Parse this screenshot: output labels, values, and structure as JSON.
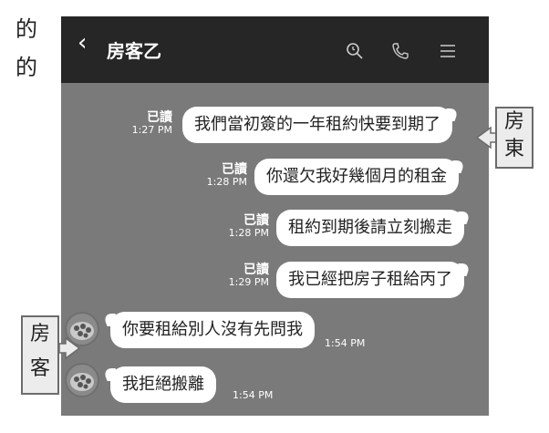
{
  "page_side_text": [
    "的",
    "的"
  ],
  "header": {
    "back_icon": "‹",
    "title": "房客乙"
  },
  "messages_right": [
    {
      "text": "我們當初簽的一年租約快要到期了",
      "status": "已讀",
      "time": "1:27 PM"
    },
    {
      "text": "你還欠我好幾個月的租金",
      "status": "已讀",
      "time": "1:28 PM"
    },
    {
      "text": "租約到期後請立刻搬走",
      "status": "已讀",
      "time": "1:28 PM"
    },
    {
      "text": "我已經把房子租給丙了",
      "status": "已讀",
      "time": "1:29 PM"
    }
  ],
  "messages_left": [
    {
      "text": "你要租給別人沒有先問我",
      "time": "1:54 PM"
    },
    {
      "text": "我拒絕搬離",
      "time": "1:54 PM"
    }
  ],
  "callouts": {
    "landlord": "房東",
    "tenant": "房客"
  },
  "colors": {
    "header": "#262626",
    "chat_bg": "#7a7a7a",
    "bubble": "#ffffff"
  }
}
